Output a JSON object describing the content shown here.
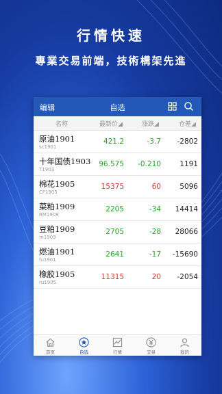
{
  "promo": {
    "title": "行情快速",
    "subtitle": "專業交易前端，技術構架先進"
  },
  "topbar": {
    "edit_label": "编辑",
    "title": "自选"
  },
  "columns": {
    "name": "名称",
    "price": "最新价",
    "change": "涨跌",
    "position": "仓差"
  },
  "rows": [
    {
      "name": "原油1901",
      "code": "sc1901",
      "price": "421.2",
      "change": "-3.7",
      "position": "-2802",
      "price_color": "#2aa52a",
      "change_color": "#2aa52a"
    },
    {
      "name": "十年国债1903",
      "code": "T1903",
      "price": "96.575",
      "change": "-0.210",
      "position": "1191",
      "price_color": "#2aa52a",
      "change_color": "#2aa52a"
    },
    {
      "name": "棉花1905",
      "code": "CF1905",
      "price": "15375",
      "change": "60",
      "position": "5096",
      "price_color": "#e23434",
      "change_color": "#e23434"
    },
    {
      "name": "菜粕1909",
      "code": "RM1909",
      "price": "2205",
      "change": "-34",
      "position": "14414",
      "price_color": "#2aa52a",
      "change_color": "#2aa52a"
    },
    {
      "name": "豆粕1909",
      "code": "m1909",
      "price": "2705",
      "change": "-28",
      "position": "28066",
      "price_color": "#2aa52a",
      "change_color": "#2aa52a"
    },
    {
      "name": "燃油1901",
      "code": "fu1901",
      "price": "2641",
      "change": "-17",
      "position": "-15690",
      "price_color": "#2aa52a",
      "change_color": "#2aa52a"
    },
    {
      "name": "橡胶1905",
      "code": "ru1905",
      "price": "11315",
      "change": "20",
      "position": "-2054",
      "price_color": "#e23434",
      "change_color": "#e23434"
    }
  ],
  "tabs": [
    {
      "label": "首页",
      "icon": "home-icon"
    },
    {
      "label": "自选",
      "icon": "star-icon"
    },
    {
      "label": "行情",
      "icon": "chart-icon"
    },
    {
      "label": "交易",
      "icon": "yen-icon"
    },
    {
      "label": "我的",
      "icon": "user-icon"
    }
  ],
  "colors": {
    "accent": "#2458b8",
    "up": "#e23434",
    "down": "#2aa52a"
  }
}
